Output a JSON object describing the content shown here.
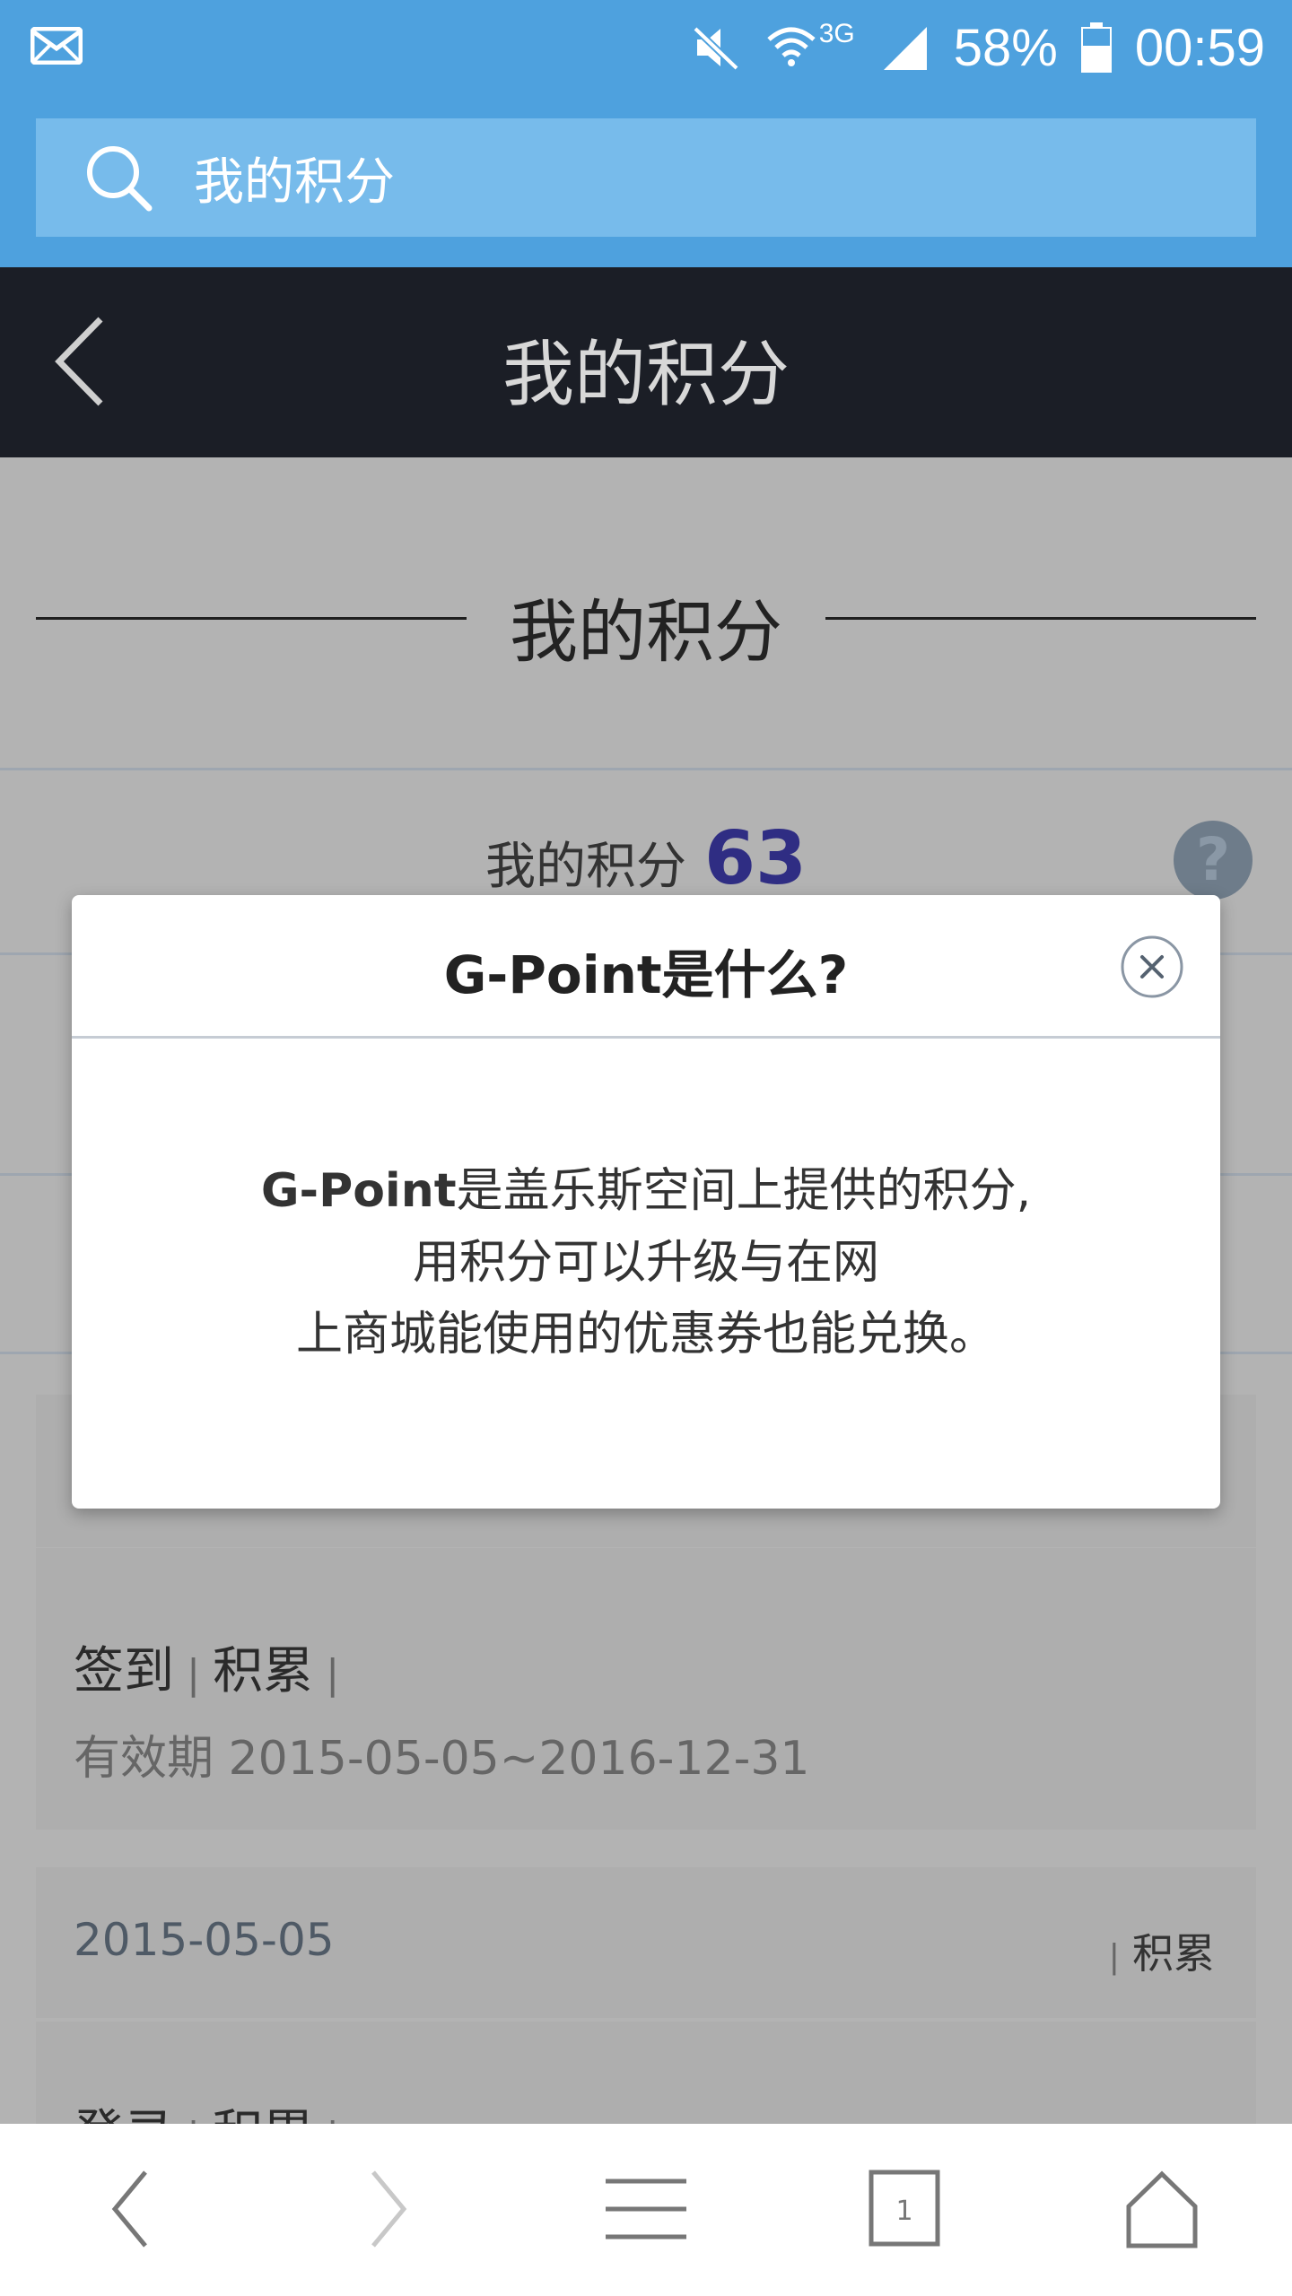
{
  "status_bar": {
    "battery_percent": "58%",
    "time": "00:59",
    "network": "3G",
    "icons": [
      "mail-icon",
      "mute-icon",
      "wifi-icon",
      "signal-icon",
      "battery-icon"
    ]
  },
  "search": {
    "text": "我的积分"
  },
  "header": {
    "title": "我的积分"
  },
  "section": {
    "title": "我的积分"
  },
  "points": {
    "label": "我的积分",
    "value": "63",
    "help": "?"
  },
  "history": [
    {
      "title": "签到",
      "type": "积累",
      "validity_label": "有效期",
      "validity": "2015-05-05~2016-12-31"
    },
    {
      "date": "2015-05-05",
      "type": "积累",
      "title": "登录",
      "type2": "积累"
    }
  ],
  "modal": {
    "title": "G-Point是什么?",
    "brand": "G-Point",
    "line1_rest": "是盖乐斯空间上提供的积分,",
    "line2": "用积分可以升级与在网",
    "line3": "上商城能使用的优惠券也能兑换。"
  },
  "bottom_nav": [
    "back-icon",
    "forward-icon",
    "menu-icon",
    "tabs-icon",
    "home-icon"
  ],
  "tabs_count": "1",
  "colors": {
    "status_blue": "#4ea1de",
    "search_blue": "#77bbeb",
    "header_dark": "#1b1e26",
    "points_accent": "#2f2d83"
  }
}
